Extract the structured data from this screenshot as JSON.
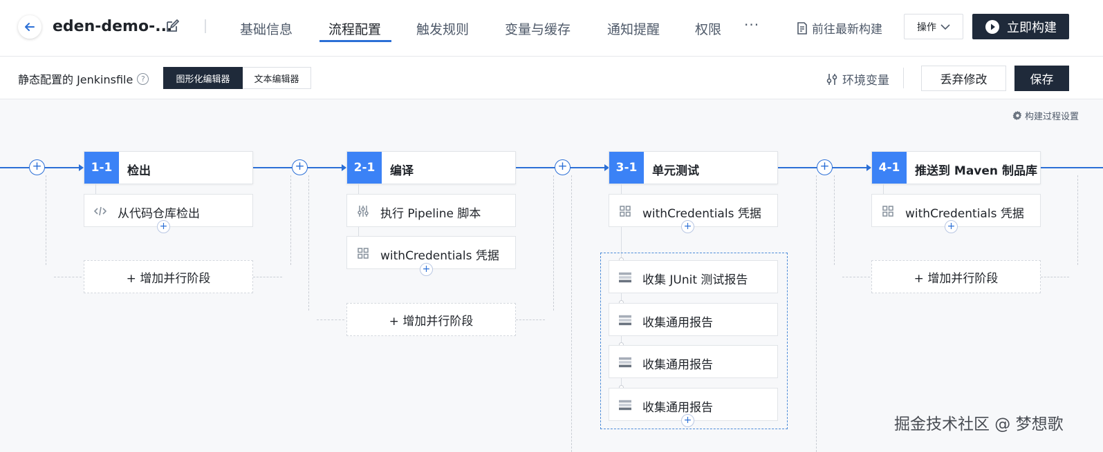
{
  "header": {
    "title": "eden-demo-...",
    "tabs": [
      "基础信息",
      "流程配置",
      "触发规则",
      "变量与缓存",
      "通知提醒",
      "权限"
    ],
    "more": "···",
    "goto_latest_build": "前往最新构建",
    "ops_label": "操作",
    "build_now": "立即构建"
  },
  "subbar": {
    "jenkinsfile_label": "静态配置的 Jenkinsfile",
    "editor_graphic": "图形化编辑器",
    "editor_text": "文本编辑器",
    "env_vars": "环境变量",
    "discard": "丢弃修改",
    "save": "保存"
  },
  "build_settings": "构建过程设置",
  "stages": [
    {
      "num": "1-1",
      "title": "检出",
      "steps": [
        "从代码仓库检出"
      ]
    },
    {
      "num": "2-1",
      "title": "编译",
      "steps": [
        "执行 Pipeline 脚本",
        "withCredentials 凭据"
      ]
    },
    {
      "num": "3-1",
      "title": "单元测试",
      "steps": [
        "withCredentials 凭据"
      ],
      "group_steps": [
        "收集 JUnit 测试报告",
        "收集通用报告",
        "收集通用报告",
        "收集通用报告"
      ]
    },
    {
      "num": "4-1",
      "title": "推送到 Maven 制品库",
      "steps": [
        "withCredentials 凭据"
      ]
    }
  ],
  "add_parallel": "+ 增加并行阶段",
  "plus": "+",
  "watermark": "掘金技术社区 @ 梦想歌",
  "colors": {
    "accent": "#2b6fd6",
    "stage_num_bg": "#3b82f6",
    "dark_button": "#1f2a3a"
  },
  "icons": [
    "back-arrow-icon",
    "edit-icon",
    "document-icon",
    "chevron-down-icon",
    "play-circle-icon",
    "help-icon",
    "sliders-icon",
    "gear-icon",
    "code-icon",
    "script-icon",
    "grid-icon",
    "report-icon"
  ]
}
